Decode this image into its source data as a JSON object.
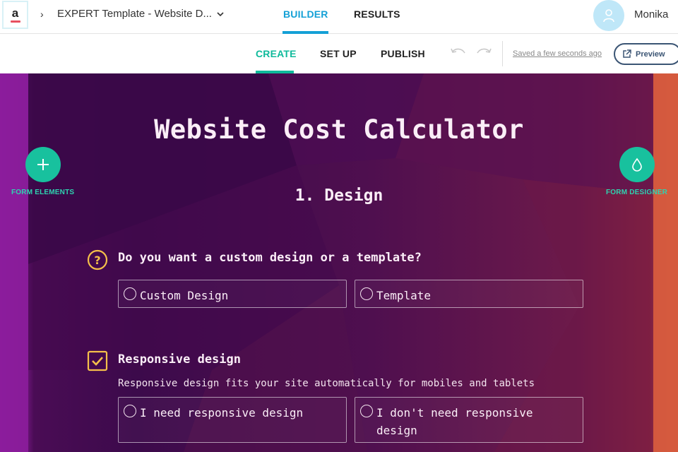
{
  "header": {
    "logo_letter": "a",
    "form_title": "EXPERT Template - Website D...",
    "tabs": [
      {
        "label": "BUILDER",
        "active": true
      },
      {
        "label": "RESULTS",
        "active": false
      }
    ],
    "user_name": "Monika"
  },
  "subbar": {
    "tabs": [
      {
        "label": "CREATE",
        "active": true
      },
      {
        "label": "SET UP",
        "active": false
      },
      {
        "label": "PUBLISH",
        "active": false
      }
    ],
    "saved_status": "Saved a few seconds ago",
    "preview_label": "Preview"
  },
  "canvas": {
    "title": "Website Cost Calculator",
    "section": "1. Design",
    "left_tool": {
      "label": "FORM ELEMENTS",
      "icon": "plus-icon"
    },
    "right_tool": {
      "label": "FORM DESIGNER",
      "icon": "droplet-icon"
    },
    "questions": [
      {
        "icon": "question-icon",
        "text": "Do you want a custom design or a template?",
        "options": [
          "Custom Design",
          "Template"
        ]
      },
      {
        "icon": "checkbox-icon",
        "text": "Responsive design",
        "description": "Responsive design fits your site automatically for mobiles and tablets",
        "options": [
          "I need responsive design",
          "I don't need responsive design"
        ]
      }
    ]
  },
  "colors": {
    "builder_accent": "#14a0d6",
    "create_accent": "#0fba9b",
    "tool_button": "#18c19e",
    "question_icon": "#f5c04a"
  }
}
